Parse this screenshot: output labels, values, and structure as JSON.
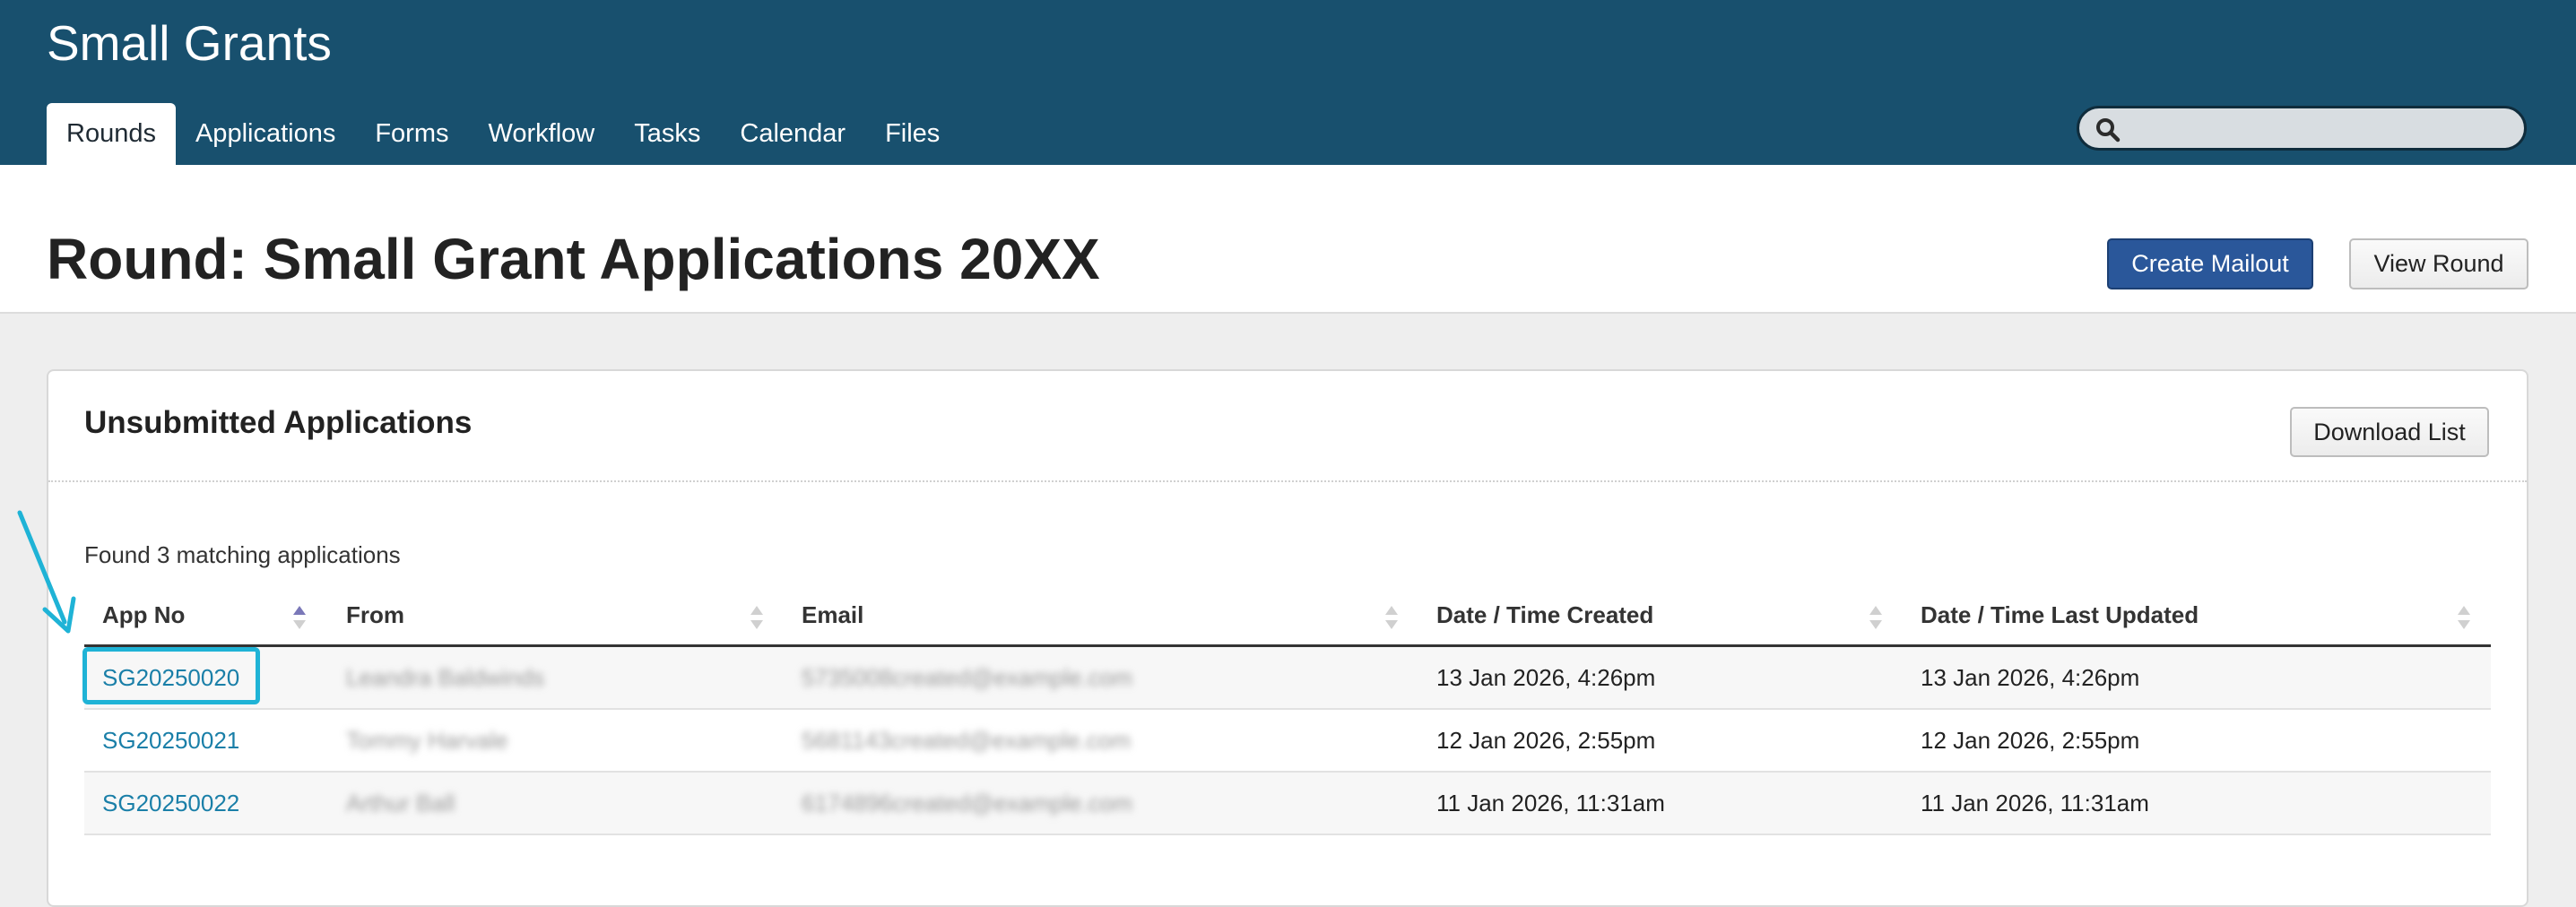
{
  "app": {
    "title": "Small Grants"
  },
  "nav": {
    "tabs": [
      {
        "label": "Rounds",
        "active": true
      },
      {
        "label": "Applications"
      },
      {
        "label": "Forms"
      },
      {
        "label": "Workflow"
      },
      {
        "label": "Tasks"
      },
      {
        "label": "Calendar"
      },
      {
        "label": "Files"
      }
    ]
  },
  "search": {
    "placeholder": "",
    "value": ""
  },
  "page": {
    "title": "Round: Small Grant Applications 20XX",
    "create_mailout_label": "Create Mailout",
    "view_round_label": "View Round"
  },
  "panel": {
    "title": "Unsubmitted Applications",
    "download_label": "Download List",
    "found_text": "Found 3 matching applications"
  },
  "table": {
    "headers": {
      "app_no": "App No",
      "from": "From",
      "email": "Email",
      "created": "Date / Time Created",
      "updated": "Date / Time Last Updated"
    },
    "rows": [
      {
        "app_no": "SG20250020",
        "from": "Leandra Baldwinds",
        "email": "5735008created@example.com",
        "created": "13 Jan 2026, 4:26pm",
        "updated": "13 Jan 2026, 4:26pm"
      },
      {
        "app_no": "SG20250021",
        "from": "Tommy Harvale",
        "email": "5681143created@example.com",
        "created": "12 Jan 2026, 2:55pm",
        "updated": "12 Jan 2026, 2:55pm"
      },
      {
        "app_no": "SG20250022",
        "from": "Arthur Ball",
        "email": "6174896created@example.com",
        "created": "11 Jan 2026, 11:31am",
        "updated": "11 Jan 2026, 11:31am"
      }
    ]
  },
  "colors": {
    "header_bg": "#18506e",
    "primary_button": "#2a579a",
    "link": "#1a7fa8",
    "highlight": "#1fb3d6"
  }
}
